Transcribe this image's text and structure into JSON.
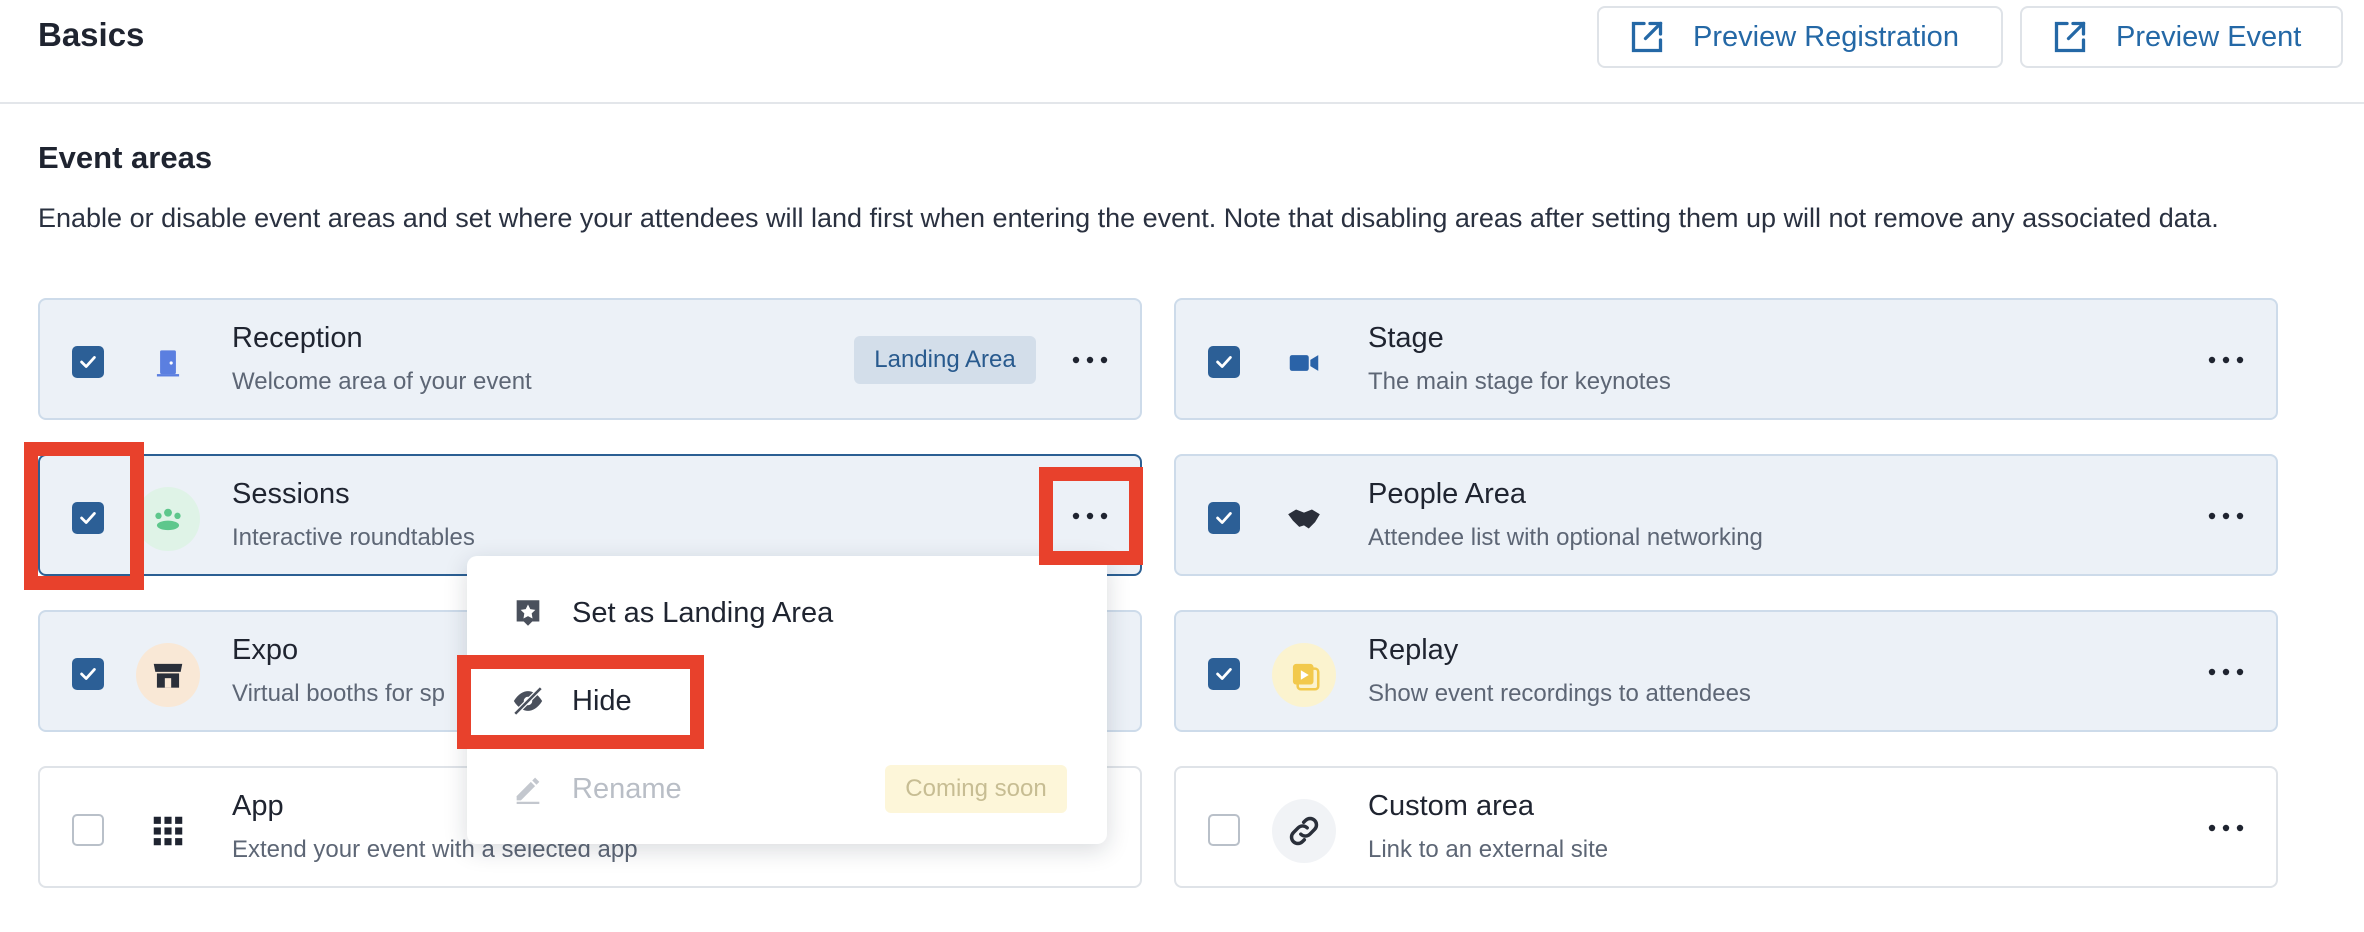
{
  "header": {
    "title": "Basics",
    "preview_registration": "Preview Registration",
    "preview_event": "Preview Event"
  },
  "section": {
    "title": "Event areas",
    "description": "Enable or disable event areas and set where your attendees will land first when entering the event. Note that disabling areas after setting them up will not remove any associated data."
  },
  "areas": {
    "reception": {
      "name": "Reception",
      "desc": "Welcome area of your event",
      "checked": true,
      "badge": "Landing Area",
      "icon": "door-icon"
    },
    "stage": {
      "name": "Stage",
      "desc": "The main stage for keynotes",
      "checked": true,
      "icon": "video-camera-icon"
    },
    "sessions": {
      "name": "Sessions",
      "desc": "Interactive roundtables",
      "checked": true,
      "icon": "group-icon"
    },
    "people": {
      "name": "People Area",
      "desc": "Attendee list with optional networking",
      "checked": true,
      "icon": "handshake-icon"
    },
    "expo": {
      "name": "Expo",
      "desc": "Virtual booths for sp",
      "checked": true,
      "icon": "booth-icon"
    },
    "replay": {
      "name": "Replay",
      "desc": "Show event recordings to attendees",
      "checked": true,
      "icon": "replay-icon"
    },
    "app": {
      "name": "App",
      "desc": "Extend your event with a selected app",
      "checked": false,
      "icon": "grid-icon"
    },
    "custom": {
      "name": "Custom area",
      "desc": "Link to an external site",
      "checked": false,
      "icon": "link-icon"
    }
  },
  "context_menu": {
    "set_landing": "Set as Landing Area",
    "hide": "Hide",
    "rename": "Rename",
    "coming_soon": "Coming soon"
  },
  "colors": {
    "accent": "#2c5f96",
    "highlight": "#e8412c",
    "card_bg": "#ecf1f7"
  }
}
